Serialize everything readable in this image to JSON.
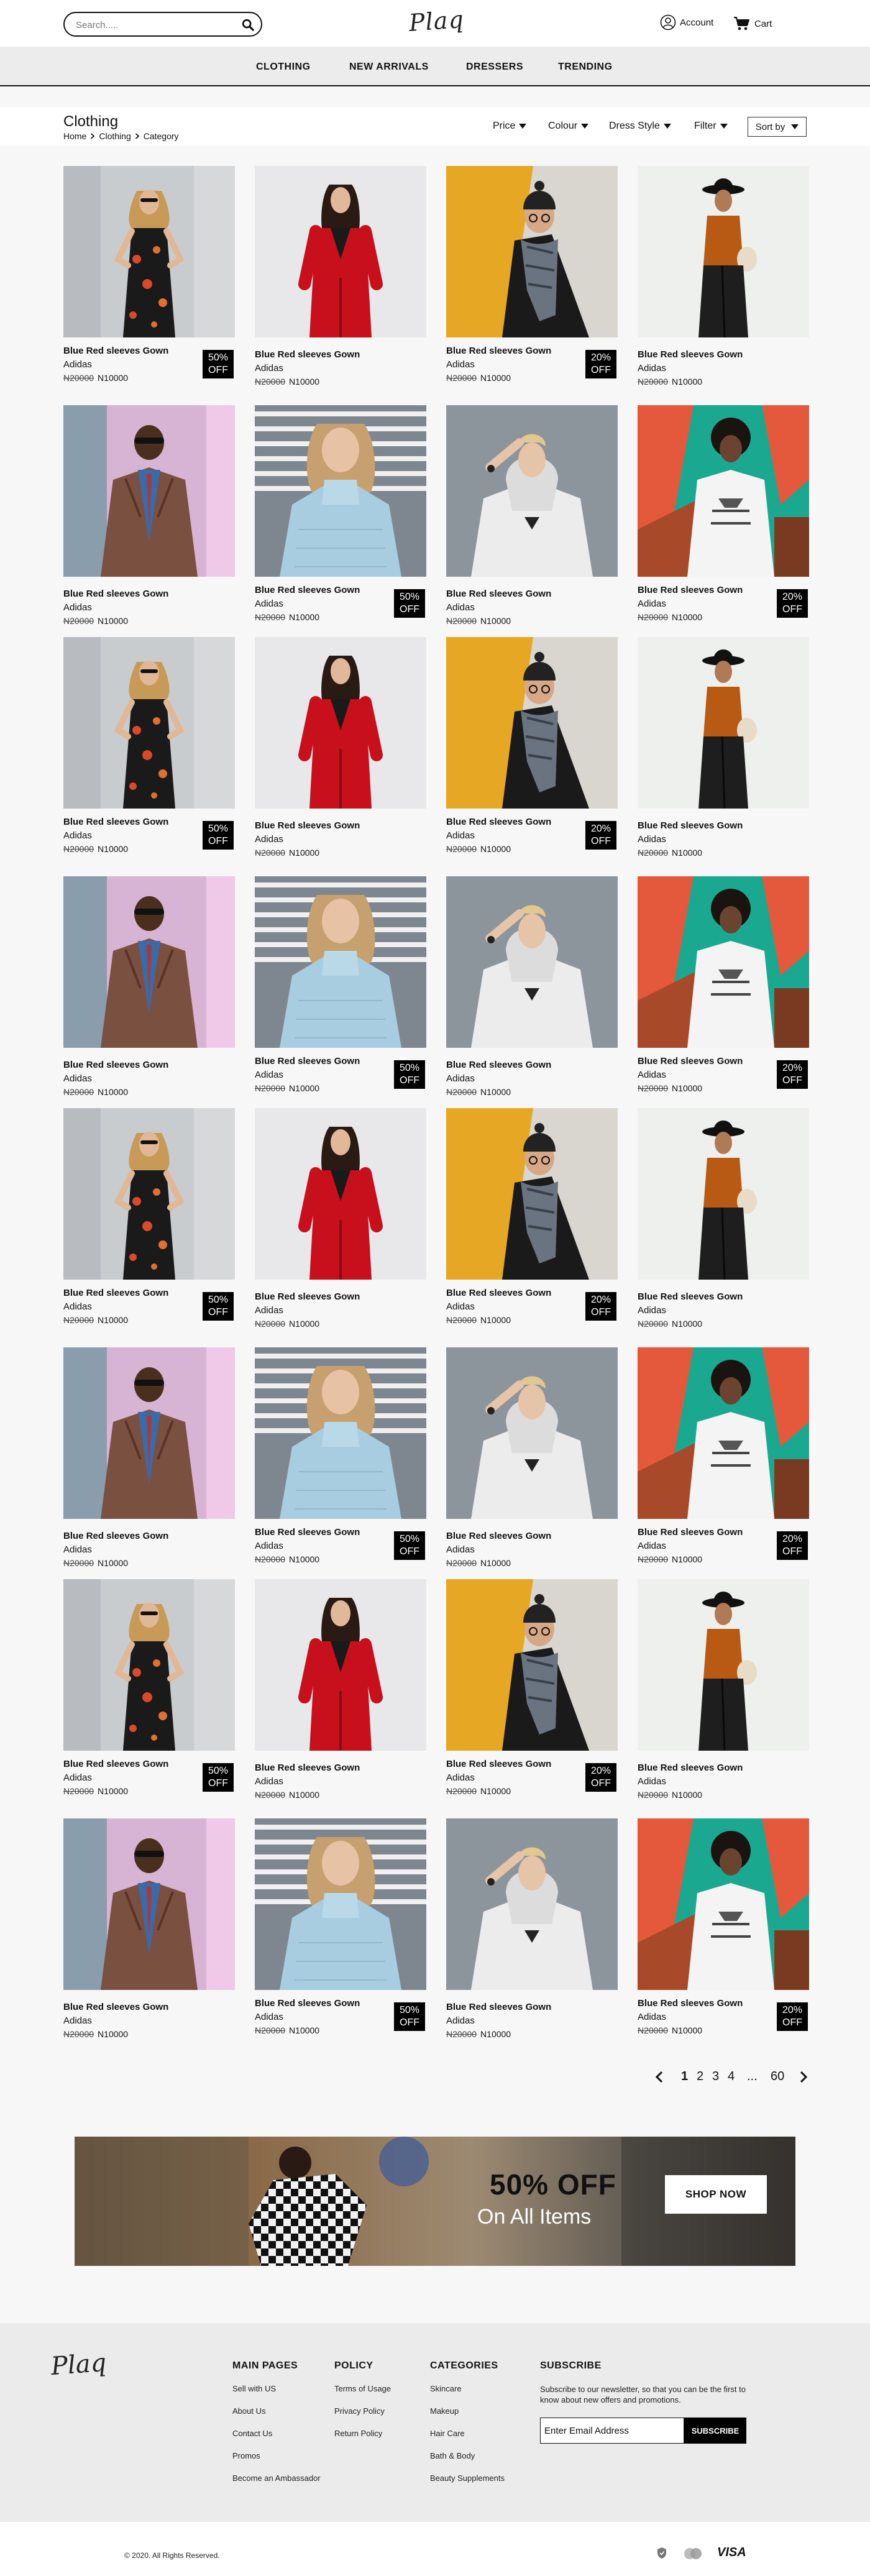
{
  "header": {
    "search_placeholder": "Search.....",
    "logo": "Plaq",
    "account_label": "Account",
    "cart_label": "Cart"
  },
  "nav": {
    "items": [
      {
        "label": "CLOTHING"
      },
      {
        "label": "NEW ARRIVALS"
      },
      {
        "label": "DRESSERS"
      },
      {
        "label": "TRENDING"
      }
    ]
  },
  "category": {
    "title": "Clothing",
    "breadcrumb": [
      "Home",
      "Clothing",
      "Category"
    ],
    "filters": [
      "Price",
      "Colour",
      "Dress Style",
      "Filter"
    ],
    "sort_label": "Sort by"
  },
  "product_defaults": {
    "name": "Blue Red sleeves Gown",
    "brand": "Adidas",
    "old_price": "N20000",
    "price": "N10000"
  },
  "products": [
    {
      "photo": "woman-floral-dress",
      "badge": "50% OFF"
    },
    {
      "photo": "woman-red-suit",
      "badge": ""
    },
    {
      "photo": "man-beanie-scarf",
      "badge": "20% OFF"
    },
    {
      "photo": "woman-hat-orange-top",
      "badge": ""
    },
    {
      "photo": "man-brown-jacket",
      "badge": ""
    },
    {
      "photo": "woman-blue-sweater",
      "badge": "50% OFF"
    },
    {
      "photo": "woman-white-hoodie",
      "badge": ""
    },
    {
      "photo": "man-graffiti-tshirt",
      "badge": "20% OFF"
    },
    {
      "photo": "woman-floral-dress",
      "badge": "50% OFF"
    },
    {
      "photo": "woman-red-suit",
      "badge": ""
    },
    {
      "photo": "man-beanie-scarf",
      "badge": "20% OFF"
    },
    {
      "photo": "woman-hat-orange-top",
      "badge": ""
    },
    {
      "photo": "man-brown-jacket",
      "badge": ""
    },
    {
      "photo": "woman-blue-sweater",
      "badge": "50% OFF"
    },
    {
      "photo": "woman-white-hoodie",
      "badge": ""
    },
    {
      "photo": "man-graffiti-tshirt",
      "badge": "20% OFF"
    },
    {
      "photo": "woman-floral-dress",
      "badge": "50% OFF"
    },
    {
      "photo": "woman-red-suit",
      "badge": ""
    },
    {
      "photo": "man-beanie-scarf",
      "badge": "20% OFF"
    },
    {
      "photo": "woman-hat-orange-top",
      "badge": ""
    },
    {
      "photo": "man-brown-jacket",
      "badge": ""
    },
    {
      "photo": "woman-blue-sweater",
      "badge": "50% OFF"
    },
    {
      "photo": "woman-white-hoodie",
      "badge": ""
    },
    {
      "photo": "man-graffiti-tshirt",
      "badge": "20% OFF"
    },
    {
      "photo": "woman-floral-dress",
      "badge": "50% OFF"
    },
    {
      "photo": "woman-red-suit",
      "badge": ""
    },
    {
      "photo": "man-beanie-scarf",
      "badge": "20% OFF"
    },
    {
      "photo": "woman-hat-orange-top",
      "badge": ""
    },
    {
      "photo": "man-brown-jacket",
      "badge": ""
    },
    {
      "photo": "woman-blue-sweater",
      "badge": "50% OFF"
    },
    {
      "photo": "woman-white-hoodie",
      "badge": ""
    },
    {
      "photo": "man-graffiti-tshirt",
      "badge": "20% OFF"
    }
  ],
  "pagination": {
    "pages": [
      "1",
      "2",
      "3",
      "4"
    ],
    "ellipsis": "...",
    "last": "60",
    "current": "1"
  },
  "banner": {
    "headline": "50% OFF",
    "subline": "On All Items",
    "cta": "SHOP NOW"
  },
  "footer": {
    "logo": "Plaq",
    "main_pages": {
      "title": "MAIN PAGES",
      "links": [
        "Sell with US",
        "About Us",
        "Contact Us",
        "Promos",
        "Become an Ambassador"
      ]
    },
    "policy": {
      "title": "POLICY",
      "links": [
        "Terms of Usage",
        "Privacy Policy",
        "Return Policy"
      ]
    },
    "categories": {
      "title": "CATEGORIES",
      "links": [
        "Skincare",
        "Makeup",
        "Hair Care",
        "Bath & Body",
        "Beauty Supplements"
      ]
    },
    "subscribe": {
      "title": "SUBSCRIBE",
      "text": "Subscribe to our newsletter, so that you can be the first to know about new offers and promotions.",
      "placeholder": "Enter Email Address",
      "button": "SUBSCRIBE"
    },
    "copyright": "© 2020. All Rights Reserved.",
    "payment_icons": [
      "shield-icon",
      "mastercard-icon",
      "visa-icon"
    ],
    "visa_label": "VISA"
  }
}
